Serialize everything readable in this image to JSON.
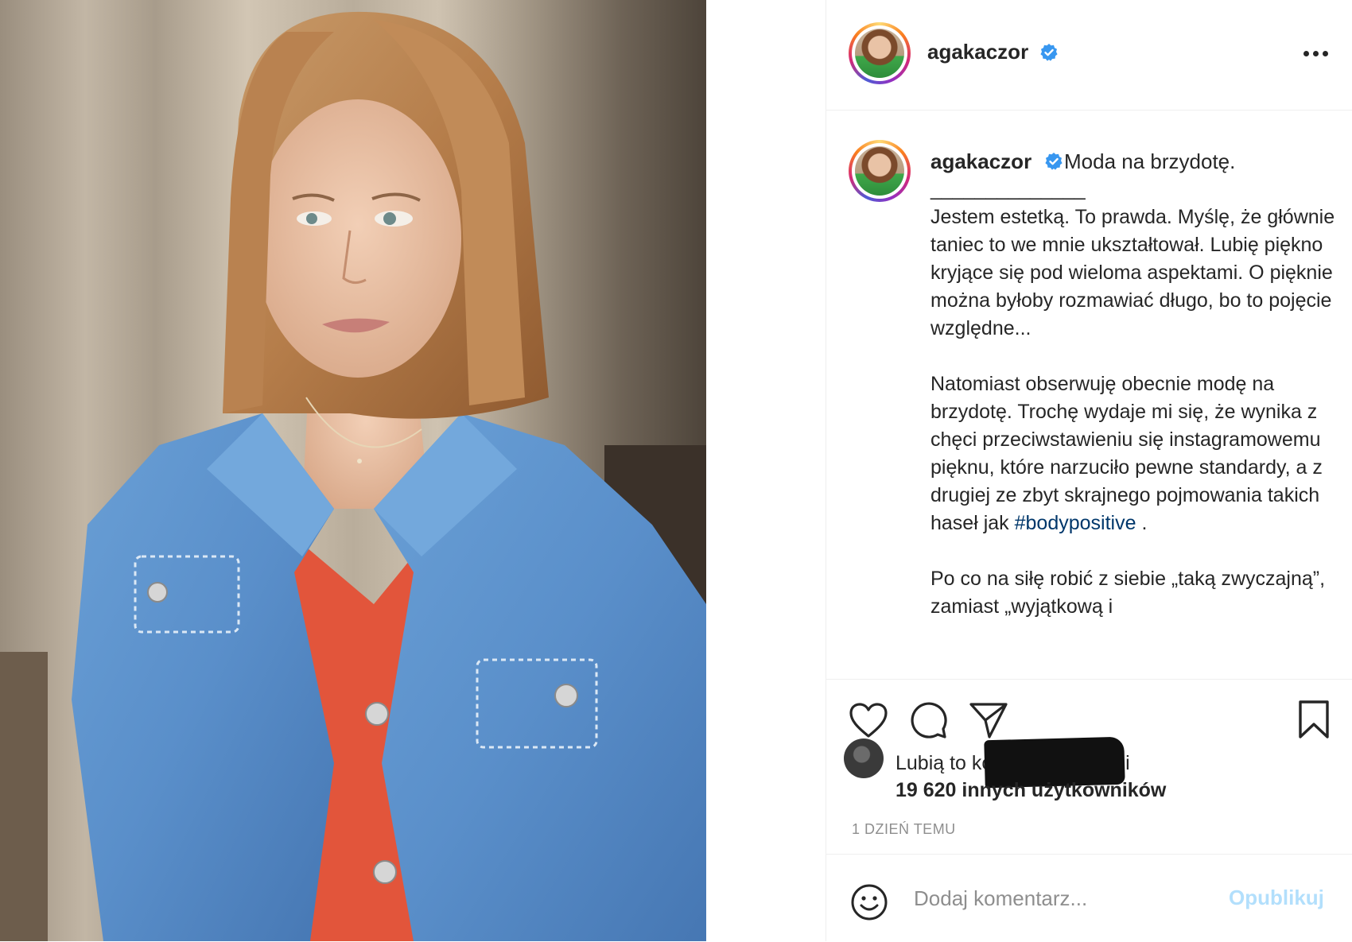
{
  "post": {
    "author": {
      "username": "agakaczor",
      "verified": true
    },
    "caption": {
      "username": "agakaczor",
      "title": "Moda na brzydotę.",
      "separator": "______________",
      "paragraphs": [
        "Jestem estetką. To prawda. Myślę, że głównie taniec to we mnie ukształtował. Lubię piękno kryjące się pod wieloma aspektami. O pięknie można byłoby rozmawiać długo, bo to pojęcie względne...",
        "Natomiast obserwuję obecnie modę na brzydotę. Trochę wydaje mi się, że wynika z chęci przeciwstawieniu się instagramowemu pięknu, które narzuciło pewne standardy, a z drugiej ze zbyt skrajnego pojmowania takich haseł jak",
        "Po co na siłę robić z siebie „taką zwyczajną”, zamiast „wyjątkową i"
      ],
      "hashtag": "#bodypositive",
      "after_hashtag": " ."
    },
    "likes": {
      "prefix": "Lubią to",
      "liker_redacted": "kobietazkrakowa",
      "suffix": "i",
      "count_text": "19 620 innych użytkowników"
    },
    "timestamp": "1 DZIEŃ TEMU",
    "comment": {
      "placeholder": "Dodaj komentarz...",
      "publish_label": "Opublikuj"
    }
  },
  "icons": {
    "more": "more-options-icon",
    "like": "heart-icon",
    "comment": "comment-bubble-icon",
    "share": "paper-plane-icon",
    "save": "bookmark-icon",
    "emoji": "emoji-smile-icon",
    "verified": "verified-badge-icon"
  },
  "colors": {
    "verified_blue": "#3897f0",
    "hashtag": "#00376b",
    "publish_disabled": "#b2dffc",
    "muted": "#8e8e8e"
  }
}
